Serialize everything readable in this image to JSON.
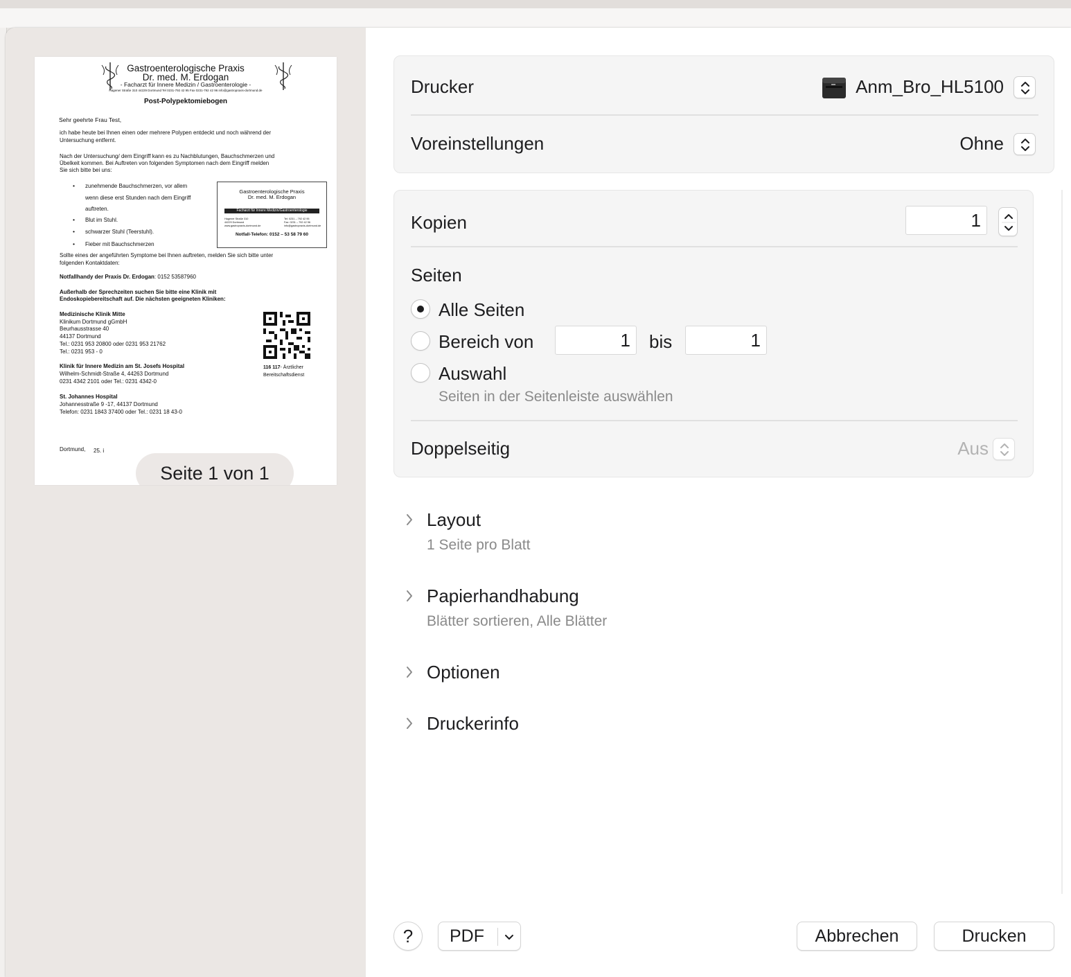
{
  "preview": {
    "page_indicator": "Seite 1 von 1",
    "document": {
      "header_line1": "Gastroenterologische Praxis",
      "header_line2": "Dr. med. M. Erdogan",
      "header_line3": "- Facharzt für Innere Medizin / Gastroenterologie -",
      "header_line4": "Hagener Straße 310   44229 Dortmund   Tel 0231-792 42 95   Fax 0231-792 42 96   info@gastropraxis-dortmund.de",
      "title": "Post-Polypektomiebogen",
      "greeting": "Sehr geehrte Frau Test,",
      "para1_line1": "ich habe heute bei Ihnen einen oder mehrere Polypen entdeckt und noch während der",
      "para1_line2": "Untersuchung entfernt.",
      "para2_line1": "Nach der Untersuchung/ dem Eingriff kann es zu Nachblutungen, Bauchschmerzen und",
      "para2_line2": "Übelkeit kommen. Bei Auftreten von folgenden Symptomen nach dem Eingriff melden",
      "para2_line3": "Sie sich bitte bei uns:",
      "bullet1_line1": "zunehmende Bauchschmerzen, vor allem",
      "bullet1_line2": "wenn diese erst Stunden nach dem Eingriff",
      "bullet1_line3": "auftreten.",
      "bullet2": "Blut im Stuhl.",
      "bullet3": "schwarzer Stuhl (Teerstuhl).",
      "bullet4": "Fieber mit Bauchschmerzen",
      "card_line1": "Gastroenterologische Praxis",
      "card_line2": "Dr. med. M. Erdogan",
      "card_band": "Facharzt für Innere Medizin/Gastroenterologie",
      "card_addr_left1": "Hagener Straße 310",
      "card_addr_left2": "44229 Dortmund",
      "card_addr_left3": "www.gastropraxis-dortmund.de",
      "card_addr_right1": "Tel: 0231 – 792 42 95",
      "card_addr_right2": "Fax: 0231 – 792 42 96",
      "card_addr_right3": "info@gastropraxis-dortmund.de",
      "card_emergency": "Notfall-Telefon: 0152 – 53 58 79 60",
      "para3_line1": "Sollte eines der angeführten Symptome bei Ihnen auftreten, melden Sie sich bitte unter",
      "para3_line2": "folgenden Kontaktdaten:",
      "emergency_label": "Notfallhandy der Praxis Dr. Erdogan",
      "emergency_number": ": 0152 53587960",
      "after_hours_line1": "Außerhalb der Sprechzeiten suchen Sie bitte eine Klinik mit",
      "after_hours_line2": "Endoskopiebereitschaft auf. Die nächsten geeigneten Kliniken:",
      "clinic1_name": "Medizinische Klinik Mitte",
      "clinic1_line1": "Klinikum Dortmund gGmbH",
      "clinic1_line2": "Beurhausstrasse 40",
      "clinic1_line3": "44137 Dortmund",
      "clinic1_line4": "Tel.: 0231 953 20800 oder 0231 953 21762",
      "clinic1_line5": "Tel.: 0231 953 - 0",
      "clinic2_name": "Klinik für Innere Medizin am St. Josefs Hospital",
      "clinic2_line1": "Wilhelm-Schmidt-Straße 4, 44263 Dortmund",
      "clinic2_line2": "0231 4342 2101 oder Tel.: 0231 4342-0",
      "clinic3_name": "St. Johannes Hospital",
      "clinic3_line1": "Johannesstraße 9 -17, 44137 Dortmund",
      "clinic3_line2": "Telefon: 0231 1843 37400 oder Tel.: 0231 18 43-0",
      "service_number": "116 117",
      "service_label_line1": "- Ärztlicher",
      "service_label_line2": "Bereitschaftsdienst",
      "footer_place": "Dortmund,",
      "footer_date_partial": "25. i"
    }
  },
  "printer": {
    "label": "Drucker",
    "value": "Anm_Bro_HL5100",
    "icon": "printer-icon"
  },
  "presets": {
    "label": "Voreinstellungen",
    "value": "Ohne"
  },
  "copies": {
    "label": "Kopien",
    "value": "1"
  },
  "pages": {
    "label": "Seiten",
    "all_label": "Alle Seiten",
    "range_label": "Bereich von",
    "range_from": "1",
    "range_to_label": "bis",
    "range_to": "1",
    "selection_label": "Auswahl",
    "selection_hint": "Seiten in der Seitenleiste auswählen",
    "selected": "all"
  },
  "duplex": {
    "label": "Doppelseitig",
    "value": "Aus"
  },
  "sections": [
    {
      "title": "Layout",
      "subtitle": "1 Seite pro Blatt"
    },
    {
      "title": "Papierhandhabung",
      "subtitle": "Blätter sortieren, Alle Blätter"
    },
    {
      "title": "Optionen",
      "subtitle": ""
    },
    {
      "title": "Druckerinfo",
      "subtitle": ""
    }
  ],
  "footer": {
    "help_label": "?",
    "pdf_label": "PDF",
    "cancel_label": "Abbrechen",
    "print_label": "Drucken"
  },
  "colors": {
    "preview_background": "#ebe7e4",
    "group_background": "#f5f5f5",
    "text": "#1d1d1f",
    "secondary_text": "#8a8a8a"
  }
}
